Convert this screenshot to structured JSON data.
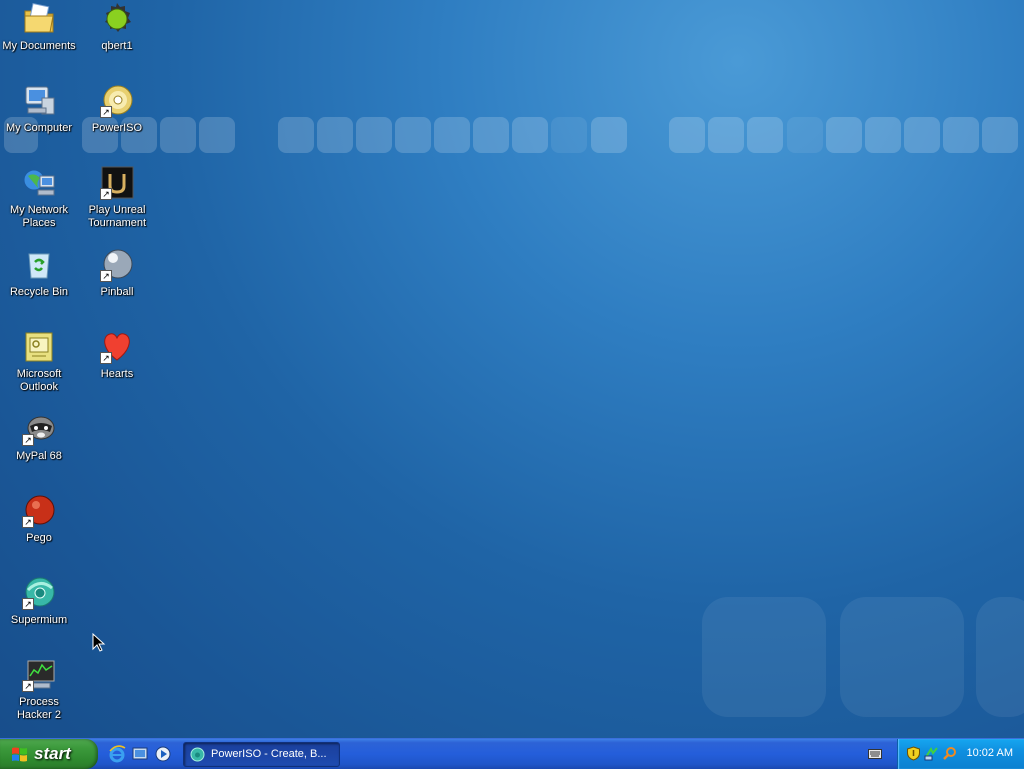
{
  "desktop": {
    "icons": [
      {
        "label": "My Documents",
        "icon": "folder-documents-icon"
      },
      {
        "label": "qbert1",
        "icon": "qbert-icon"
      },
      {
        "label": "My Computer",
        "icon": "computer-icon"
      },
      {
        "label": "PowerISO",
        "icon": "poweriso-disc-icon"
      },
      {
        "label": "My Network Places",
        "icon": "network-places-icon"
      },
      {
        "label": "Play Unreal Tournament",
        "icon": "unreal-tournament-icon"
      },
      {
        "label": "Recycle Bin",
        "icon": "recycle-bin-icon"
      },
      {
        "label": "Pinball",
        "icon": "pinball-icon"
      },
      {
        "label": "Microsoft Outlook",
        "icon": "outlook-icon"
      },
      {
        "label": "Hearts",
        "icon": "hearts-icon"
      },
      {
        "label": "MyPal 68",
        "icon": "mypal-icon"
      },
      {
        "label": "Pego",
        "icon": "pego-icon"
      },
      {
        "label": "Supermium",
        "icon": "supermium-icon"
      },
      {
        "label": "Process Hacker 2",
        "icon": "process-hacker-icon"
      }
    ]
  },
  "taskbar": {
    "start_label": "start",
    "quick_launch": [
      "internet-explorer-icon",
      "show-desktop-icon",
      "media-player-icon"
    ],
    "window_button_label": "PowerISO - Create, B...",
    "window_button_icon": "supermium-icon",
    "tray_icons": [
      "keyboard-icon",
      "security-shield-icon",
      "network-icon",
      "search-icon"
    ],
    "clock": "10:02 AM"
  },
  "colors": {
    "desktop_blue": "#1f64a6",
    "taskbar_blue": "#245edb",
    "start_green": "#3c9a3c",
    "tray_blue": "#0f8fe0"
  }
}
